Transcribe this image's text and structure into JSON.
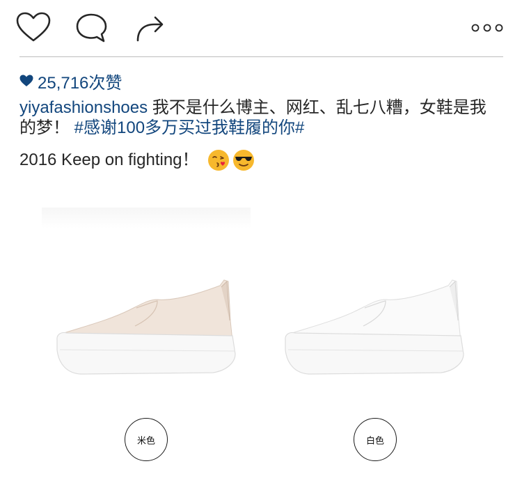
{
  "post": {
    "likes": "25,716次赞",
    "username": "yiyafashionshoes",
    "caption_text": " 我不是什么博主、网红、乱七八糟，女鞋是我的梦！ ",
    "hashtag": "#感谢100多万买过我鞋履的你#",
    "caption_line2": "2016 Keep on fighting！"
  },
  "icons": {
    "like": "heart-icon",
    "comment": "comment-icon",
    "share": "share-arrow-icon",
    "more": "more-dots-icon",
    "likes_indicator": "filled-heart-icon",
    "emoji_1": "kissing-face-emoji",
    "emoji_2": "sunglasses-face-emoji"
  },
  "product": {
    "colors": [
      {
        "label": "米色"
      },
      {
        "label": "白色"
      }
    ]
  },
  "theme": {
    "link_color": "#12467d",
    "text_color": "#262626",
    "icon_color": "#262626",
    "beige_shoe": "#f0e4da",
    "white_shoe": "#fafafa"
  }
}
